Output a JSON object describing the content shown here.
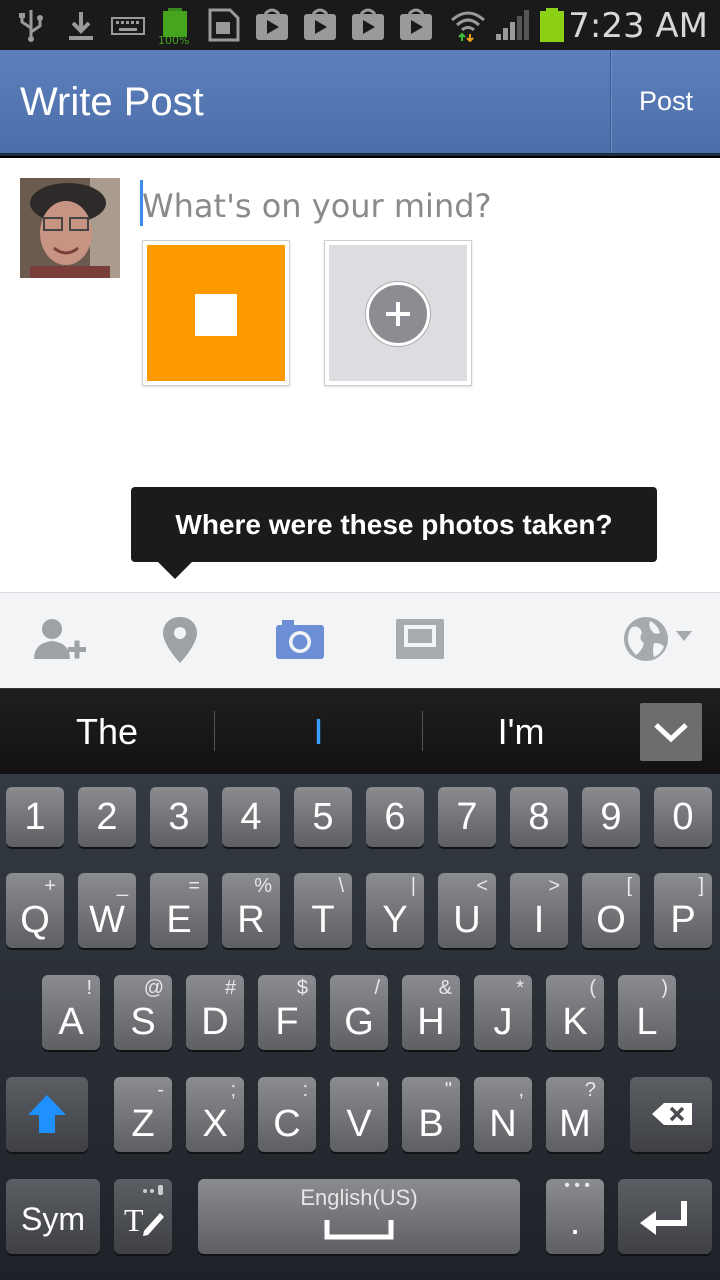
{
  "status_bar": {
    "time": "7:23 AM",
    "battery_small_label": "100%",
    "icons": [
      "usb-icon",
      "download-icon",
      "keyboard-icon",
      "battery-full-icon",
      "sd-card-icon",
      "play-store-icon",
      "play-store-icon",
      "play-store-icon",
      "play-store-icon",
      "wifi-icon",
      "signal-icon",
      "battery-icon"
    ]
  },
  "app_bar": {
    "title": "Write Post",
    "post_label": "Post",
    "color": "#4c6ea9"
  },
  "composer": {
    "placeholder": "What's on your mind?",
    "value": "",
    "photo_tile_color": "#fd9a00"
  },
  "tooltip": {
    "text": "Where were these photos taken?"
  },
  "action_bar": {
    "icons": [
      "tag-people-icon",
      "location-pin-icon",
      "camera-icon",
      "photo-album-icon",
      "globe-privacy-icon"
    ],
    "active_color": "#6d8fd6"
  },
  "suggestions": {
    "items": [
      "The",
      "I",
      "I'm"
    ],
    "highlight_color": "#3aa0ff"
  },
  "keyboard": {
    "numbers": [
      "1",
      "2",
      "3",
      "4",
      "5",
      "6",
      "7",
      "8",
      "9",
      "0"
    ],
    "row1": [
      {
        "key": "Q",
        "alt": "+"
      },
      {
        "key": "W",
        "alt": "_"
      },
      {
        "key": "E",
        "alt": "="
      },
      {
        "key": "R",
        "alt": "%"
      },
      {
        "key": "T",
        "alt": "\\"
      },
      {
        "key": "Y",
        "alt": "|"
      },
      {
        "key": "U",
        "alt": "<"
      },
      {
        "key": "I",
        "alt": ">"
      },
      {
        "key": "O",
        "alt": "["
      },
      {
        "key": "P",
        "alt": "]"
      }
    ],
    "row2": [
      {
        "key": "A",
        "alt": "!"
      },
      {
        "key": "S",
        "alt": "@"
      },
      {
        "key": "D",
        "alt": "#"
      },
      {
        "key": "F",
        "alt": "$"
      },
      {
        "key": "G",
        "alt": "/"
      },
      {
        "key": "H",
        "alt": "&"
      },
      {
        "key": "J",
        "alt": "*"
      },
      {
        "key": "K",
        "alt": "("
      },
      {
        "key": "L",
        "alt": ")"
      }
    ],
    "row3": [
      {
        "key": "Z",
        "alt": "-"
      },
      {
        "key": "X",
        "alt": ";"
      },
      {
        "key": "C",
        "alt": ":"
      },
      {
        "key": "V",
        "alt": "'"
      },
      {
        "key": "B",
        "alt": "\""
      },
      {
        "key": "N",
        "alt": ","
      },
      {
        "key": "M",
        "alt": "?"
      }
    ],
    "sym_label": "Sym",
    "space_label": "English(US)",
    "period_label": ".",
    "shift_color": "#1e90ff"
  }
}
